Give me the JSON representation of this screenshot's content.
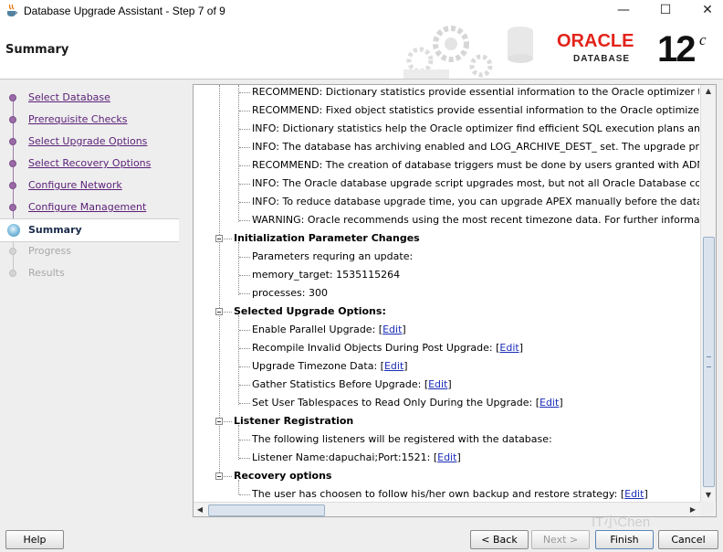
{
  "window": {
    "title": "Database Upgrade Assistant - Step 7 of 9",
    "controls": [
      "minimize",
      "maximize",
      "close"
    ]
  },
  "header": {
    "page_title": "Summary",
    "brand": "ORACLE",
    "brand_sub": "DATABASE",
    "version": "12",
    "version_suffix": "c"
  },
  "nav": {
    "items": [
      {
        "label": "Select Database",
        "state": "done"
      },
      {
        "label": "Prerequisite Checks",
        "state": "done"
      },
      {
        "label": "Select Upgrade Options",
        "state": "done"
      },
      {
        "label": "Select Recovery Options",
        "state": "done"
      },
      {
        "label": "Configure Network",
        "state": "done"
      },
      {
        "label": "Configure Management",
        "state": "done"
      },
      {
        "label": "Summary",
        "state": "current"
      },
      {
        "label": "Progress",
        "state": "pending"
      },
      {
        "label": "Results",
        "state": "pending"
      }
    ]
  },
  "tree": {
    "recommendations": [
      "RECOMMEND: Dictionary statistics provide essential information to the Oracle optimizer to h",
      "RECOMMEND: Fixed object statistics provide essential information to the Oracle optimizer to",
      "INFO: Dictionary statistics help the Oracle optimizer find efficient SQL execution plans and a",
      "INFO: The database has archiving enabled and LOG_ARCHIVE_DEST_ set. The upgrade proce",
      "RECOMMEND: The creation of database triggers must be done by users granted with ADMINI",
      "INFO: The Oracle database upgrade script upgrades most, but not all Oracle Database comp",
      "INFO: To reduce database upgrade time, you can upgrade APEX manually before the databas",
      "WARNING: Oracle recommends using the most recent timezone data. For further information"
    ],
    "init_params": {
      "title": "Initialization Parameter Changes",
      "items": [
        "Parameters requring an update:",
        "memory_target: 1535115264",
        "processes: 300"
      ]
    },
    "upgrade_options": {
      "title": "Selected Upgrade Options:",
      "items": [
        {
          "text": "Enable Parallel Upgrade: ",
          "link": "Edit"
        },
        {
          "text": "Recompile Invalid Objects During Post Upgrade: ",
          "link": "Edit"
        },
        {
          "text": "Upgrade Timezone Data: ",
          "link": "Edit"
        },
        {
          "text": "Gather Statistics Before Upgrade: ",
          "link": "Edit"
        },
        {
          "text": "Set User Tablespaces to Read Only During the Upgrade: ",
          "link": "Edit"
        }
      ]
    },
    "listener": {
      "title": "Listener Registration",
      "items": [
        {
          "text": "The following listeners will be registered with the database:",
          "link": ""
        },
        {
          "text": "Listener Name:dapuchai;Port:1521: ",
          "link": "Edit"
        }
      ]
    },
    "recovery": {
      "title": "Recovery options",
      "items": [
        {
          "text": "The user has choosen to follow his/her own backup and restore strategy: ",
          "link": "Edit"
        }
      ]
    }
  },
  "buttons": {
    "help": "Help",
    "back": "< Back",
    "next": "Next >",
    "finish": "Finish",
    "cancel": "Cancel"
  },
  "watermark": "IT小Chen"
}
